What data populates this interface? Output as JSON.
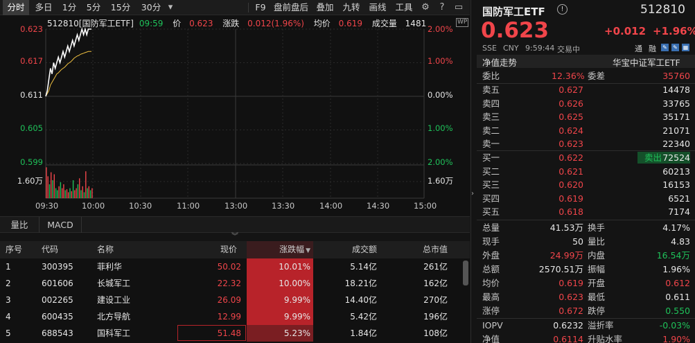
{
  "toolbar": {
    "left": [
      "分时",
      "多日",
      "1分",
      "5分",
      "15分",
      "30分"
    ],
    "right": [
      "F9",
      "盘前盘后",
      "叠加",
      "九转",
      "画线",
      "工具"
    ]
  },
  "chart": {
    "info": {
      "code_name": "512810[国防军工ETF]",
      "time": "09:59",
      "price_label": "价",
      "price": "0.623",
      "change_label": "涨跌",
      "change": "0.012(1.96%)",
      "avg_label": "均价",
      "avg": "0.619",
      "vol_label": "成交量",
      "vol": "1481"
    },
    "y_left": [
      "0.623",
      "0.617",
      "0.611",
      "0.605",
      "0.599"
    ],
    "y_right": [
      "2.00%",
      "1.00%",
      "0.00%",
      "1.00%",
      "2.00%"
    ],
    "vol_left": "1.60万",
    "vol_right": "1.60万",
    "x_ticks": [
      "09:30",
      "10:00",
      "10:30",
      "11:00",
      "13:00",
      "13:30",
      "14:00",
      "14:30",
      "15:00"
    ],
    "colors": {
      "up": "#f0454a",
      "down": "#1fc25a",
      "price_line": "#ffffff",
      "avg_line": "#f0c040"
    }
  },
  "chart_data": {
    "type": "line",
    "ylim": [
      0.599,
      0.623
    ],
    "price": [
      0.611,
      0.612,
      0.614,
      0.616,
      0.615,
      0.617,
      0.616,
      0.617,
      0.618,
      0.617,
      0.618,
      0.619,
      0.618,
      0.619,
      0.62,
      0.619,
      0.62,
      0.621,
      0.62,
      0.621,
      0.622,
      0.621,
      0.622,
      0.623,
      0.622,
      0.623,
      0.622,
      0.623,
      0.623,
      0.623
    ],
    "avg": [
      0.611,
      0.6115,
      0.612,
      0.613,
      0.6135,
      0.614,
      0.6145,
      0.615,
      0.6152,
      0.6155,
      0.6158,
      0.616,
      0.6162,
      0.6165,
      0.6168,
      0.617,
      0.6172,
      0.6175,
      0.6178,
      0.618,
      0.6182,
      0.6183,
      0.6185,
      0.6186,
      0.6187,
      0.6188,
      0.6189,
      0.619,
      0.619,
      0.619
    ],
    "volume_sign": [
      "u",
      "u",
      "d",
      "u",
      "d",
      "u",
      "d",
      "d",
      "u",
      "d",
      "u",
      "u",
      "d",
      "u",
      "u",
      "d",
      "u",
      "d",
      "u",
      "u",
      "d",
      "u",
      "d",
      "u",
      "d",
      "u",
      "d",
      "u",
      "d",
      "u"
    ],
    "volume": [
      1.55,
      1.1,
      0.7,
      1.3,
      0.9,
      1.2,
      0.5,
      0.4,
      0.6,
      0.8,
      0.5,
      0.7,
      0.4,
      0.45,
      0.3,
      0.5,
      0.35,
      0.9,
      0.4,
      0.5,
      0.7,
      1.0,
      0.4,
      0.6,
      0.3,
      1.35,
      0.5,
      0.6,
      0.4,
      0.5
    ]
  },
  "tabs": [
    "量比",
    "MACD"
  ],
  "table": {
    "headers": [
      "序号",
      "代码",
      "名称",
      "现价",
      "涨跌幅",
      "成交额",
      "总市值"
    ],
    "rows": [
      [
        "1",
        "300395",
        "菲利华",
        "50.02",
        "10.01%",
        "5.14亿",
        "261亿"
      ],
      [
        "2",
        "601606",
        "长城军工",
        "22.32",
        "10.00%",
        "18.21亿",
        "162亿"
      ],
      [
        "3",
        "002265",
        "建设工业",
        "26.09",
        "9.99%",
        "14.40亿",
        "270亿"
      ],
      [
        "4",
        "600435",
        "北方导航",
        "12.99",
        "9.99%",
        "5.42亿",
        "196亿"
      ],
      [
        "5",
        "688543",
        "国科军工",
        "51.48",
        "5.23%",
        "1.84亿",
        "108亿"
      ]
    ]
  },
  "quote": {
    "name": "国防军工ETF",
    "code": "512810",
    "price": "0.623",
    "change": "+0.012",
    "change_pct": "+1.96%",
    "exchange": "SSE",
    "currency": "CNY",
    "time": "9:59:44",
    "status": "交易中",
    "tags": [
      "通",
      "融"
    ],
    "nav_trend": "净值走势",
    "fund_co": "华宝中证军工ETF",
    "wb_label": "委比",
    "wb": "12.36%",
    "wc_label": "委差",
    "wc": "35760",
    "asks": [
      {
        "label": "卖五",
        "price": "0.627",
        "vol": "14478"
      },
      {
        "label": "卖四",
        "price": "0.626",
        "vol": "33765"
      },
      {
        "label": "卖三",
        "price": "0.625",
        "vol": "35171"
      },
      {
        "label": "卖二",
        "price": "0.624",
        "vol": "21071"
      },
      {
        "label": "卖一",
        "price": "0.623",
        "vol": "22340"
      }
    ],
    "bids": [
      {
        "label": "买一",
        "price": "0.622",
        "vol": "72524",
        "tag": "卖出"
      },
      {
        "label": "买二",
        "price": "0.621",
        "vol": "60213"
      },
      {
        "label": "买三",
        "price": "0.620",
        "vol": "16153"
      },
      {
        "label": "买四",
        "price": "0.619",
        "vol": "6521"
      },
      {
        "label": "买五",
        "price": "0.618",
        "vol": "7174"
      }
    ],
    "stats": [
      {
        "l1": "总量",
        "v1": "41.53万",
        "c1": "white",
        "l2": "换手",
        "v2": "4.17%",
        "c2": "white"
      },
      {
        "l1": "现手",
        "v1": "50",
        "c1": "white",
        "l2": "量比",
        "v2": "4.83",
        "c2": "white"
      },
      {
        "l1": "外盘",
        "v1": "24.99万",
        "c1": "red",
        "l2": "内盘",
        "v2": "16.54万",
        "c2": "green"
      },
      {
        "l1": "总额",
        "v1": "2570.51万",
        "c1": "white",
        "l2": "振幅",
        "v2": "1.96%",
        "c2": "white"
      },
      {
        "l1": "均价",
        "v1": "0.619",
        "c1": "red",
        "l2": "开盘",
        "v2": "0.612",
        "c2": "red"
      },
      {
        "l1": "最高",
        "v1": "0.623",
        "c1": "red",
        "l2": "最低",
        "v2": "0.611",
        "c2": "white"
      },
      {
        "l1": "涨停",
        "v1": "0.672",
        "c1": "red",
        "l2": "跌停",
        "v2": "0.550",
        "c2": "green"
      }
    ],
    "iopv_label": "IOPV",
    "iopv": "0.6232",
    "premium_label": "溢折率",
    "premium": "-0.03%",
    "nav_label": "净值",
    "nav": "0.6114",
    "rise_label": "升贴水率",
    "rise": "1.90%"
  }
}
